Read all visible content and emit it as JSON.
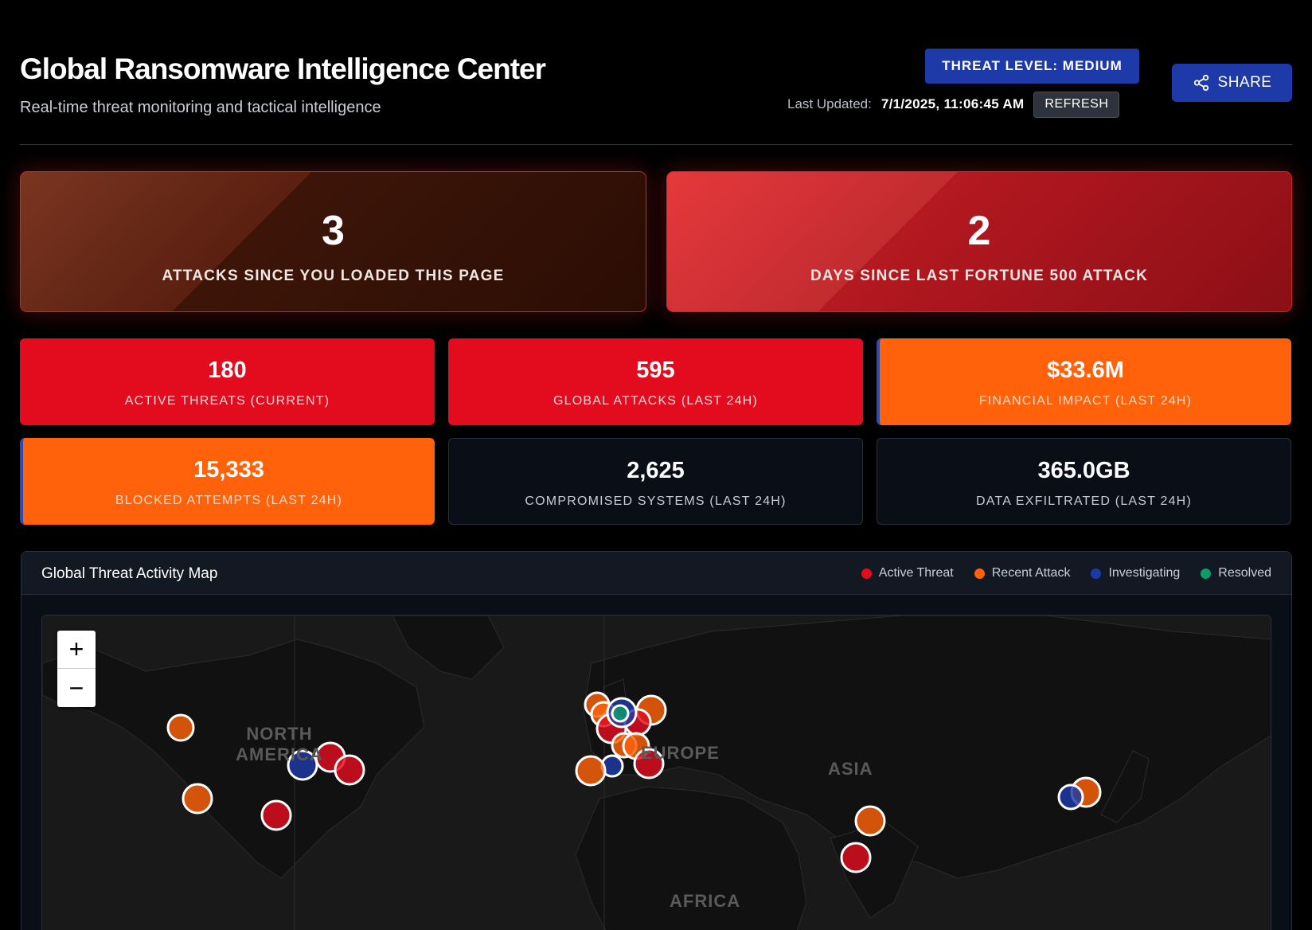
{
  "header": {
    "title": "Global Ransomware Intelligence Center",
    "subtitle": "Real-time threat monitoring and tactical intelligence",
    "threat_level": "THREAT LEVEL: MEDIUM",
    "last_updated_label": "Last Updated:",
    "last_updated_value": "7/1/2025, 11:06:45 AM",
    "refresh_label": "REFRESH",
    "share_label": "SHARE",
    "share_icon": "share-icon"
  },
  "highlight_cards": [
    {
      "value": "3",
      "label": "ATTACKS SINCE YOU LOADED THIS PAGE"
    },
    {
      "value": "2",
      "label": "DAYS SINCE LAST FORTUNE 500 ATTACK"
    }
  ],
  "stats": [
    {
      "value": "180",
      "label": "ACTIVE THREATS (CURRENT)"
    },
    {
      "value": "595",
      "label": "GLOBAL ATTACKS (LAST 24H)"
    },
    {
      "value": "$33.6M",
      "label": "FINANCIAL IMPACT (LAST 24H)"
    },
    {
      "value": "15,333",
      "label": "BLOCKED ATTEMPTS (LAST 24H)"
    },
    {
      "value": "2,625",
      "label": "COMPROMISED SYSTEMS (LAST 24H)"
    },
    {
      "value": "365.0GB",
      "label": "DATA EXFILTRATED (LAST 24H)"
    }
  ],
  "map": {
    "title": "Global Threat Activity Map",
    "legend": [
      {
        "label": "Active Threat",
        "color": "#e20c1e"
      },
      {
        "label": "Recent Attack",
        "color": "#ff620a"
      },
      {
        "label": "Investigating",
        "color": "#1d3aa8"
      },
      {
        "label": "Resolved",
        "color": "#0e9b6a"
      }
    ],
    "zoom_in": "+",
    "zoom_out": "−",
    "regions": {
      "north_america": "NORTH AMERICA",
      "europe": "EUROPE",
      "asia": "ASIA",
      "africa": "AFRICA"
    }
  },
  "colors": {
    "accent_blue": "#1d3aa8",
    "active_red": "#e20c1e",
    "recent_orange": "#ff620a",
    "resolved_green": "#0e9b6a"
  }
}
